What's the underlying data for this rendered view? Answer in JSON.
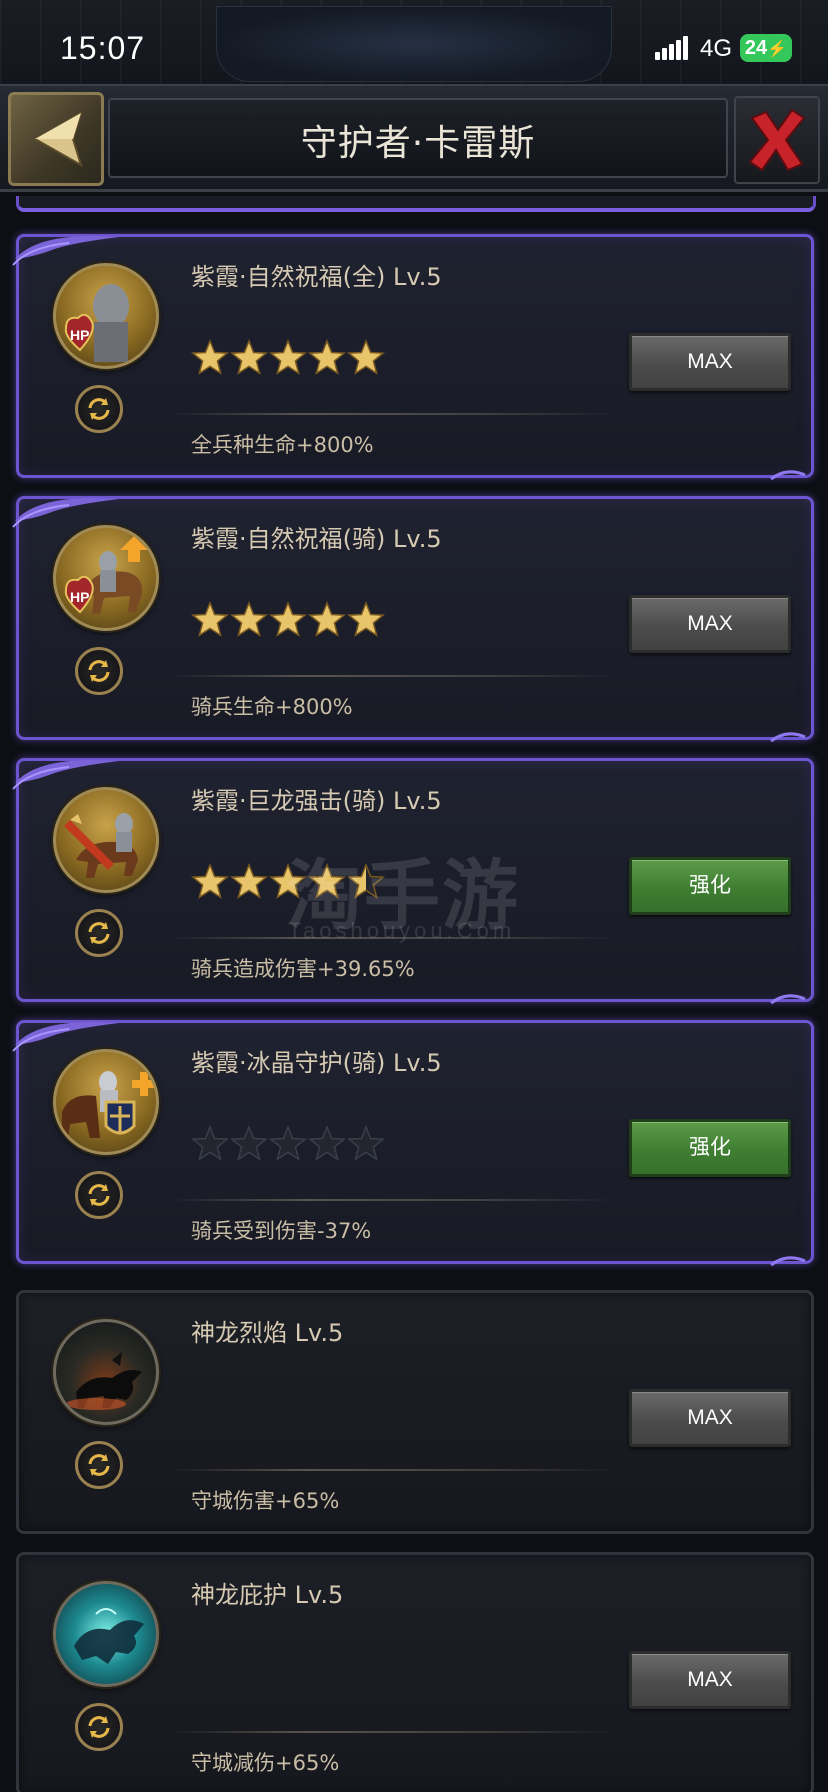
{
  "status_bar": {
    "time": "15:07",
    "network": "4G",
    "battery": "24"
  },
  "header": {
    "title": "守护者·卡雷斯",
    "back_icon": "back-arrow-icon",
    "close_icon": "close-x-icon"
  },
  "skills": [
    {
      "name": "紫霞·自然祝福(全) Lv.5",
      "stars": 5,
      "effect": "全兵种生命+800%",
      "button": "MAX",
      "button_type": "max",
      "tier": "purple",
      "portrait": "infantry-hp-portrait"
    },
    {
      "name": "紫霞·自然祝福(骑) Lv.5",
      "stars": 5,
      "effect": "骑兵生命+800%",
      "button": "MAX",
      "button_type": "max",
      "tier": "purple",
      "portrait": "cavalry-hp-portrait"
    },
    {
      "name": "紫霞·巨龙强击(骑) Lv.5",
      "stars": 4.5,
      "effect": "骑兵造成伤害+39.65%",
      "button": "强化",
      "button_type": "upgrade",
      "tier": "purple",
      "portrait": "cavalry-attack-portrait"
    },
    {
      "name": "紫霞·冰晶守护(骑) Lv.5",
      "stars": 0,
      "effect": "骑兵受到伤害-37%",
      "button": "强化",
      "button_type": "upgrade",
      "tier": "purple",
      "portrait": "cavalry-defense-portrait"
    },
    {
      "name": "神龙烈焰 Lv.5",
      "stars": null,
      "effect": "守城伤害+65%",
      "button": "MAX",
      "button_type": "max",
      "tier": "plain",
      "portrait": "dragon-flame-portrait"
    },
    {
      "name": "神龙庇护 Lv.5",
      "stars": null,
      "effect": "守城减伤+65%",
      "button": "MAX",
      "button_type": "max",
      "tier": "plain",
      "portrait": "dragon-shield-portrait"
    }
  ],
  "watermark": {
    "main": "淘手游",
    "sub": "Taoshouyou.Com"
  },
  "colors": {
    "purple_border": "#6e55d0",
    "max_button": "#555555",
    "upgrade_button": "#4a8a3c",
    "star_gold": "#e8c46a"
  }
}
